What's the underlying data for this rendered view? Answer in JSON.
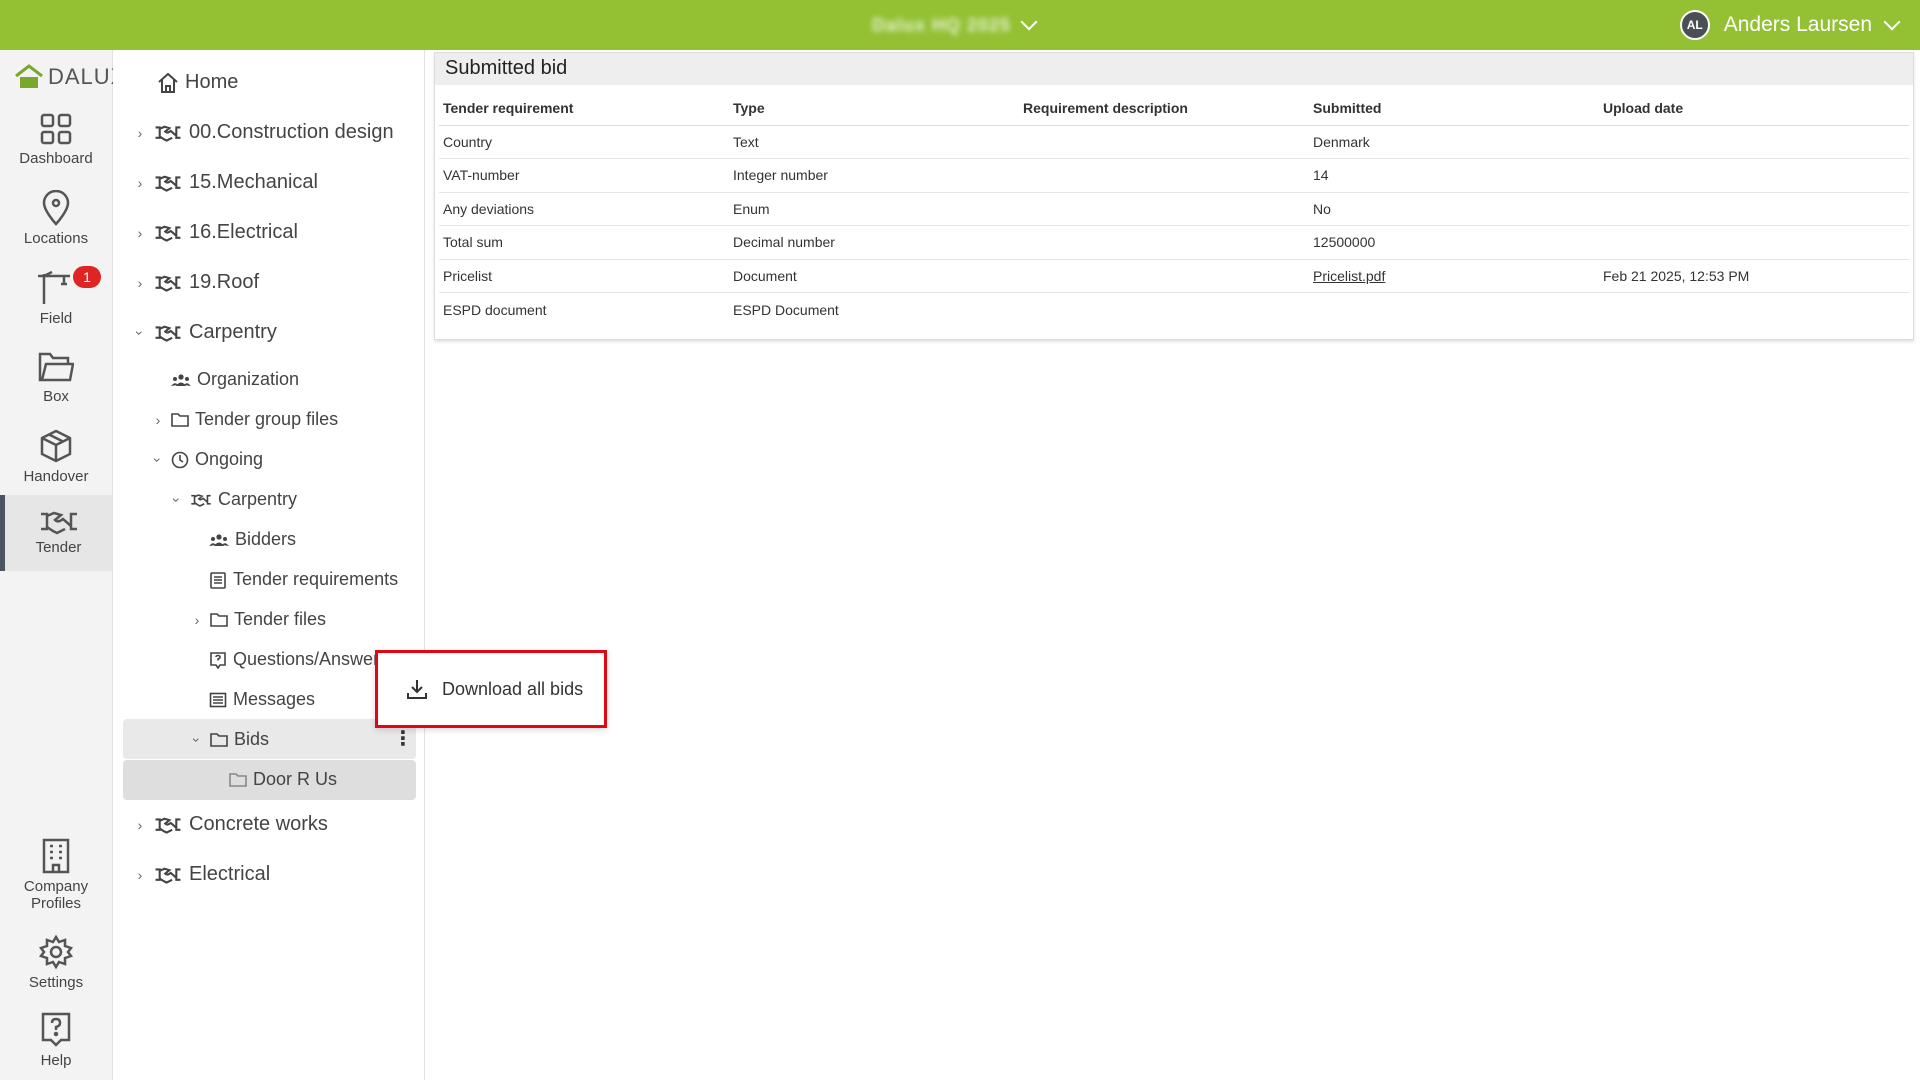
{
  "header": {
    "project_name": "Dalux HQ 2025",
    "user_initials": "AL",
    "user_name": "Anders Laursen",
    "bg_color": "#93c133"
  },
  "rail": {
    "logo": "DALUX",
    "items": [
      {
        "label": "Dashboard",
        "icon": "dashboard-grid-icon"
      },
      {
        "label": "Locations",
        "icon": "location-pin-icon"
      },
      {
        "label": "Field",
        "icon": "crane-icon",
        "badge": "1"
      },
      {
        "label": "Box",
        "icon": "folder-icon"
      },
      {
        "label": "Handover",
        "icon": "package-box-icon"
      },
      {
        "label": "Tender",
        "icon": "handshake-icon",
        "active": true
      },
      {
        "label": "Company\nProfiles",
        "label1": "Company",
        "label2": "Profiles",
        "icon": "building-icon"
      },
      {
        "label": "Settings",
        "icon": "gear-icon"
      },
      {
        "label": "Help",
        "icon": "help-question-icon"
      }
    ]
  },
  "tree": {
    "home": "Home",
    "groups": [
      "00.Construction design",
      "15.Mechanical",
      "16.Electrical",
      "19.Roof",
      "Carpentry"
    ],
    "carpentry_children": {
      "organization": "Organization",
      "tender_group_files": "Tender group files",
      "ongoing": "Ongoing",
      "carpentry": "Carpentry",
      "bidders": "Bidders",
      "tender_requirements": "Tender requirements",
      "tender_files": "Tender files",
      "questions_answers": "Questions/Answers",
      "messages": "Messages",
      "bids": "Bids",
      "door_r_us": "Door R Us"
    },
    "bottom_groups": [
      "Concrete works",
      "Electrical"
    ]
  },
  "main": {
    "title": "Submitted bid",
    "columns": [
      "Tender requirement",
      "Type",
      "Requirement description",
      "Submitted",
      "Upload date"
    ],
    "rows": [
      {
        "requirement": "Country",
        "type": "Text",
        "description": "",
        "submitted": "Denmark",
        "upload_date": ""
      },
      {
        "requirement": "VAT-number",
        "type": "Integer number",
        "description": "",
        "submitted": "14",
        "upload_date": ""
      },
      {
        "requirement": "Any deviations",
        "type": "Enum",
        "description": "",
        "submitted": "No",
        "upload_date": ""
      },
      {
        "requirement": "Total sum",
        "type": "Decimal number",
        "description": "",
        "submitted": "12500000",
        "upload_date": ""
      },
      {
        "requirement": "Pricelist",
        "type": "Document",
        "description": "",
        "submitted": "Pricelist.pdf",
        "upload_date": "Feb 21 2025, 12:53 PM"
      },
      {
        "requirement": "ESPD document",
        "type": "ESPD Document",
        "description": "",
        "submitted": "",
        "upload_date": ""
      }
    ]
  },
  "popup": {
    "label": "Download all bids",
    "highlight_color": "#e20613"
  }
}
